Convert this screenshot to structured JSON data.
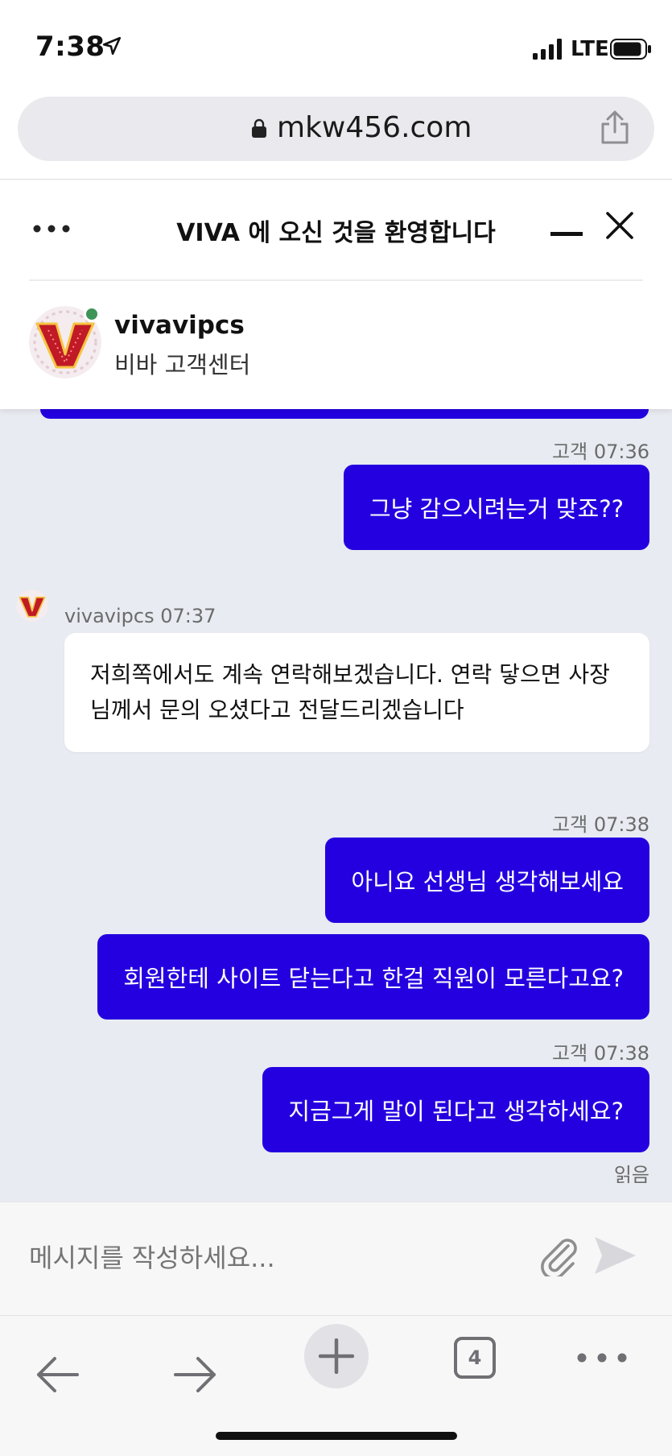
{
  "status_bar": {
    "time": "7:38",
    "network": "LTE"
  },
  "browser": {
    "url": "mkw456.com",
    "tab_count": "4"
  },
  "chat": {
    "title": "VIVA 에 오신 것을 환영합니다",
    "agent": {
      "name": "vivavipcs",
      "subtitle": "비바 고객센터"
    }
  },
  "messages": {
    "m1_meta": "고객 07:36",
    "m1_text": "그냥 감으시려는거 맞죠??",
    "m2_meta": "vivavipcs 07:37",
    "m2_text": "저희쪽에서도 계속 연락해보겠습니다. 연락 닿으면 사장님께서 문의 오셨다고 전달드리겠습니다",
    "m3_meta": "고객 07:38",
    "m3_text": "아니요 선생님 생각해보세요",
    "m4_text": "회원한테 사이트 닫는다고 한걸 직원이 모른다고요?",
    "m5_meta": "고객 07:38",
    "m5_text": "지금그게 말이 된다고 생각하세요?",
    "read_receipt": "읽음"
  },
  "composer": {
    "placeholder": "메시지를 작성하세요..."
  },
  "colors": {
    "accent": "#2400e0",
    "chat_bg": "#e8ebf1",
    "online": "#3e9457"
  }
}
